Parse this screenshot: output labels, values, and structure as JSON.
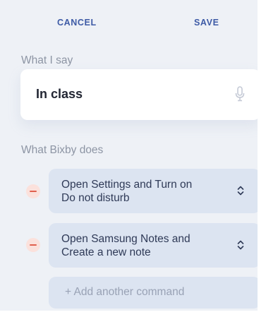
{
  "header": {
    "cancel_label": "CANCEL",
    "save_label": "SAVE"
  },
  "what_i_say": {
    "label": "What I say",
    "value": "In class",
    "icon": "microphone-icon"
  },
  "what_bixby_does": {
    "label": "What Bixby does",
    "commands": [
      {
        "line1": "Open Settings and Turn on",
        "line2": "Do not disturb",
        "remove_icon": "minus-circle-icon",
        "expand_icon": "chevron-up-down-icon"
      },
      {
        "line1": "Open Samsung Notes and",
        "line2": "Create a new note",
        "remove_icon": "minus-circle-icon",
        "expand_icon": "chevron-up-down-icon"
      }
    ],
    "add_label": "+ Add another command"
  },
  "colors": {
    "background": "#eef1f6",
    "accent": "#3e5ba6",
    "card": "#dce4f1",
    "remove": "#e0604e"
  }
}
